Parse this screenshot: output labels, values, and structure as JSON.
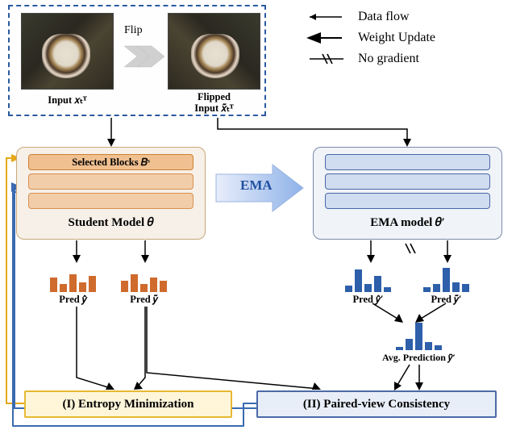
{
  "legend": {
    "dataflow": "Data flow",
    "weight": "Weight Update",
    "nograd": "No gradient"
  },
  "input": {
    "x_label": "Input 𝑥ₜᵀ",
    "flip": "Flip",
    "xt_label": "Flipped\nInput 𝑥̃ₜᵀ"
  },
  "student": {
    "selected": "Selected Blocks 𝐵ˢ",
    "title": "Student Model 𝜃"
  },
  "ema_arrow": "EMA",
  "ema": {
    "title": "EMA model 𝜃′"
  },
  "pred": {
    "yhat": "Pred 𝑦̂",
    "ytilde": "Pred 𝑦̃",
    "yhatp": "Pred 𝑦̂′",
    "ytildep": "Pred 𝑦̃′",
    "avg": "Avg. Prediction 𝑦̄′"
  },
  "loss": {
    "entropy": "(I) Entropy Minimization",
    "consist": "(II) Paired-view Consistency"
  },
  "chart_data": {
    "type": "bar",
    "note": "Schematic illustrative bar heights (no axes in figure)",
    "student_pred_yhat": [
      18,
      10,
      22,
      12,
      20
    ],
    "student_pred_ytilde": [
      14,
      22,
      10,
      18,
      14
    ],
    "ema_pred_yhatp": [
      8,
      28,
      10,
      20,
      6
    ],
    "ema_pred_ytildep": [
      6,
      10,
      30,
      12,
      10
    ],
    "ema_avg_ybarp": [
      4,
      14,
      34,
      10,
      6
    ]
  }
}
